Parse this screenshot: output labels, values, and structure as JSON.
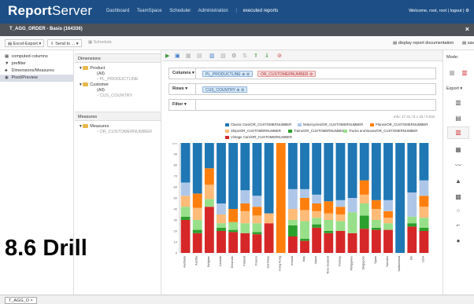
{
  "header": {
    "brand_bold": "Report",
    "brand_light": "Server",
    "nav": [
      "Dashboard",
      "TeamSpace",
      "Scheduler",
      "Administration"
    ],
    "current": "executed reports",
    "welcome": "Welcome, root, root | logout | ⚙"
  },
  "titlebar": {
    "title": "T_AGG_ORDER - Basis (164336)",
    "close": "×"
  },
  "toolbar": {
    "export_label": "Excel-Export",
    "send_label": "Send to ...",
    "schedule_label": "Schedule",
    "doc_label": "display report documentation",
    "save_label": "save"
  },
  "left_panel": {
    "items": [
      {
        "icon": "▦",
        "label": "computed columns"
      },
      {
        "icon": "▼",
        "label": "prefilter"
      },
      {
        "icon": "♣",
        "label": "Dimensions/Measures"
      },
      {
        "icon": "◉",
        "label": "Pivot/Preview"
      }
    ]
  },
  "dim_panel": {
    "dimensions_title": "Dimensions",
    "product": "Product",
    "product_all": "(All)",
    "product_leaf": "PL_PRODUCTLINE",
    "customer": "Customer",
    "customer_all": "(All)",
    "customer_leaf": "CUS_COUNTRY",
    "measures_title": "Measures",
    "measures": "Measures",
    "measures_leaf": "OR_CUSTOMERNUMBER"
  },
  "pivot": {
    "columns_label": "Columns",
    "rows_label": "Rows",
    "filter_label": "Filter",
    "columns_chips": [
      "PL_PRODUCTLINE ⊕ ⚙",
      "OR_CUSTOMERNUMBER ⚙"
    ],
    "rows_chip": "CUS_COUNTRY ⊕ ⚙",
    "info": "Info: 17.31 / 8 x 33 / 0.03s"
  },
  "right_panel": {
    "mode_label": "Mode:",
    "export_label": "Export"
  },
  "bottom": {
    "tab_label": "T_AGG_O",
    "tab_close": "×"
  },
  "overlay_text": "8.6   Drill",
  "colors": {
    "header_bg": "#1d4f86",
    "titlebar_bg": "#4d5158"
  },
  "chart_data": {
    "type": "bar",
    "stacked": true,
    "ylim": [
      0,
      100
    ],
    "yticks": [
      0,
      10,
      20,
      30,
      40,
      50,
      60,
      70,
      80,
      90,
      100
    ],
    "categories": [
      "Australia",
      "Austria",
      "Belgium",
      "Canada",
      "Denmark",
      "Finland",
      "France",
      "Germany",
      "Hong Kong",
      "Ireland",
      "Italy",
      "Japan",
      "New Zealand",
      "Norway",
      "Philippines",
      "Singapore",
      "Spain",
      "Sweden",
      "Switzerland",
      "UK",
      "USA"
    ],
    "series": [
      {
        "name": "Vintage Cars/OR_CUSTOMERNUMBER",
        "color": "#d62728",
        "values": [
          30,
          18,
          42,
          20,
          19,
          18,
          17,
          27,
          0,
          15,
          11,
          23,
          18,
          20,
          18,
          22,
          21,
          21,
          0,
          24,
          20
        ]
      },
      {
        "name": "Trains/OR_CUSTOMERNUMBER",
        "color": "#2ca02c",
        "values": [
          3,
          3,
          0,
          3,
          2,
          0,
          2,
          0,
          0,
          10,
          2,
          3,
          2,
          0,
          0,
          12,
          2,
          0,
          0,
          3,
          3
        ]
      },
      {
        "name": "Trucks and Buses/OR_CUSTOMERNUMBER",
        "color": "#98df8a",
        "values": [
          9,
          9,
          7,
          4,
          7,
          9,
          8,
          0,
          0,
          5,
          16,
          6,
          10,
          9,
          19,
          11,
          7,
          6,
          0,
          6,
          9
        ]
      },
      {
        "name": "Ships/OR_CUSTOMERNUMBER",
        "color": "#ffbb78",
        "values": [
          10,
          11,
          13,
          8,
          0,
          11,
          7,
          9,
          0,
          10,
          10,
          6,
          6,
          6,
          0,
          8,
          10,
          5,
          0,
          0,
          10
        ]
      },
      {
        "name": "Planes/OR_CUSTOMERNUMBER",
        "color": "#ff7f0e",
        "values": [
          0,
          13,
          15,
          0,
          12,
          7,
          8,
          0,
          100,
          0,
          11,
          7,
          11,
          7,
          0,
          13,
          8,
          6,
          0,
          0,
          10
        ]
      },
      {
        "name": "Motorcycles/OR_CUSTOMERNUMBER",
        "color": "#aec7e8",
        "values": [
          12,
          0,
          0,
          10,
          0,
          12,
          10,
          0,
          0,
          18,
          8,
          8,
          0,
          6,
          13,
          0,
          0,
          10,
          0,
          22,
          14
        ]
      },
      {
        "name": "Classic Cars/OR_CUSTOMERNUMBER",
        "color": "#1f77b4",
        "values": [
          36,
          46,
          23,
          55,
          60,
          43,
          48,
          64,
          0,
          42,
          42,
          47,
          53,
          52,
          50,
          34,
          52,
          52,
          100,
          45,
          34
        ]
      }
    ]
  }
}
